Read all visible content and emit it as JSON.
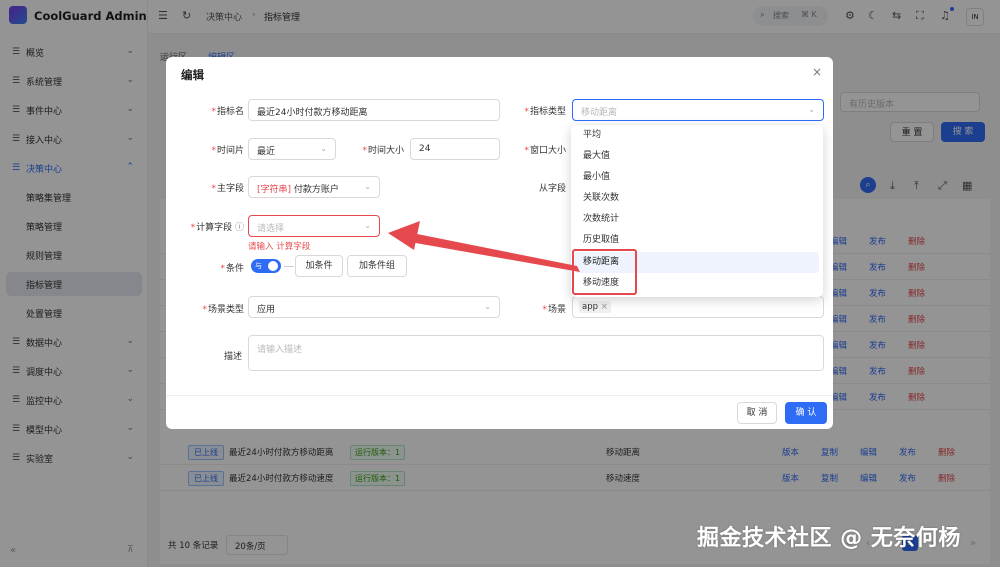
{
  "app": {
    "title": "CoolGuard Admin",
    "avatar": "IN"
  },
  "sidebar": {
    "items": [
      {
        "label": "概览",
        "icon": "menu-icon",
        "chevron": "⌄"
      },
      {
        "label": "系统管理",
        "icon": "menu-icon",
        "chevron": "⌄"
      },
      {
        "label": "事件中心",
        "icon": "menu-icon",
        "chevron": "⌄"
      },
      {
        "label": "接入中心",
        "icon": "menu-icon",
        "chevron": "⌄"
      },
      {
        "label": "决策中心",
        "icon": "menu-icon",
        "chevron": "⌃"
      },
      {
        "label": "策略集管理"
      },
      {
        "label": "策略管理"
      },
      {
        "label": "规则管理"
      },
      {
        "label": "指标管理"
      },
      {
        "label": "处置管理"
      },
      {
        "label": "数据中心",
        "icon": "menu-icon",
        "chevron": "⌄"
      },
      {
        "label": "调度中心",
        "icon": "menu-icon",
        "chevron": "⌄"
      },
      {
        "label": "监控中心",
        "icon": "menu-icon",
        "chevron": "⌄"
      },
      {
        "label": "模型中心",
        "icon": "menu-icon",
        "chevron": "⌄"
      },
      {
        "label": "实验室",
        "icon": "menu-icon",
        "chevron": "⌄"
      }
    ],
    "collapse_icon": "«",
    "pin_icon": "⊼"
  },
  "topbar": {
    "breadcrumb": [
      "决策中心",
      "指标管理"
    ],
    "search_label": "搜索",
    "search_shortcut": "⌘ K"
  },
  "background": {
    "tabs": [
      "运行区",
      "编辑区"
    ],
    "version_placeholder": "有历史版本",
    "reset_label": "重 置",
    "search_label": "搜 索",
    "rows": [
      {
        "status": "已上线",
        "name": "最近24小时付款方移动距离",
        "version": "运行版本：1",
        "type": "移动距离"
      },
      {
        "status": "已上线",
        "name": "最近24小时付款方移动速度",
        "version": "运行版本：1",
        "type": "移动速度"
      }
    ],
    "row_actions": [
      "版本",
      "复制",
      "编辑",
      "发布",
      "删除"
    ],
    "bg_actions": [
      "编辑",
      "发布",
      "删除"
    ],
    "total": "共 10 条记录",
    "page_size": "20条/页",
    "current_page": "1"
  },
  "modal": {
    "title": "编辑",
    "close": "×",
    "fields": {
      "name_label": "指标名",
      "name_value": "最近24小时付款方移动距离",
      "type_label": "指标类型",
      "type_placeholder": "移动距离",
      "time_slice_label": "时间片",
      "time_slice_value": "最近",
      "time_size_label": "时间大小",
      "time_size_value": "24",
      "window_label": "窗口大小",
      "main_field_label": "主字段",
      "main_field_type": "[字符串]",
      "main_field_value": "付款方账户",
      "sub_field_label": "从字段",
      "calc_field_label": "计算字段",
      "calc_field_placeholder": "请选择",
      "calc_field_error": "请输入 计算字段",
      "cond_label": "条件",
      "cond_toggle": "与",
      "add_cond": "加条件",
      "add_cond_group": "加条件组",
      "scene_type_label": "场景类型",
      "scene_type_value": "应用",
      "scene_label": "场景",
      "scene_chip": "app",
      "desc_label": "描述",
      "desc_placeholder": "请输入描述"
    },
    "cancel_label": "取 消",
    "ok_label": "确 认"
  },
  "dropdown": {
    "options": [
      "平均",
      "最大值",
      "最小值",
      "关联次数",
      "次数统计",
      "历史取值",
      "移动距离",
      "移动速度"
    ],
    "selected": "移动距离"
  },
  "watermark": "掘金技术社区 @ 无奈何杨",
  "colors": {
    "primary": "#2f6cf6",
    "error": "#e5484d",
    "annotation": "#e5484d"
  }
}
